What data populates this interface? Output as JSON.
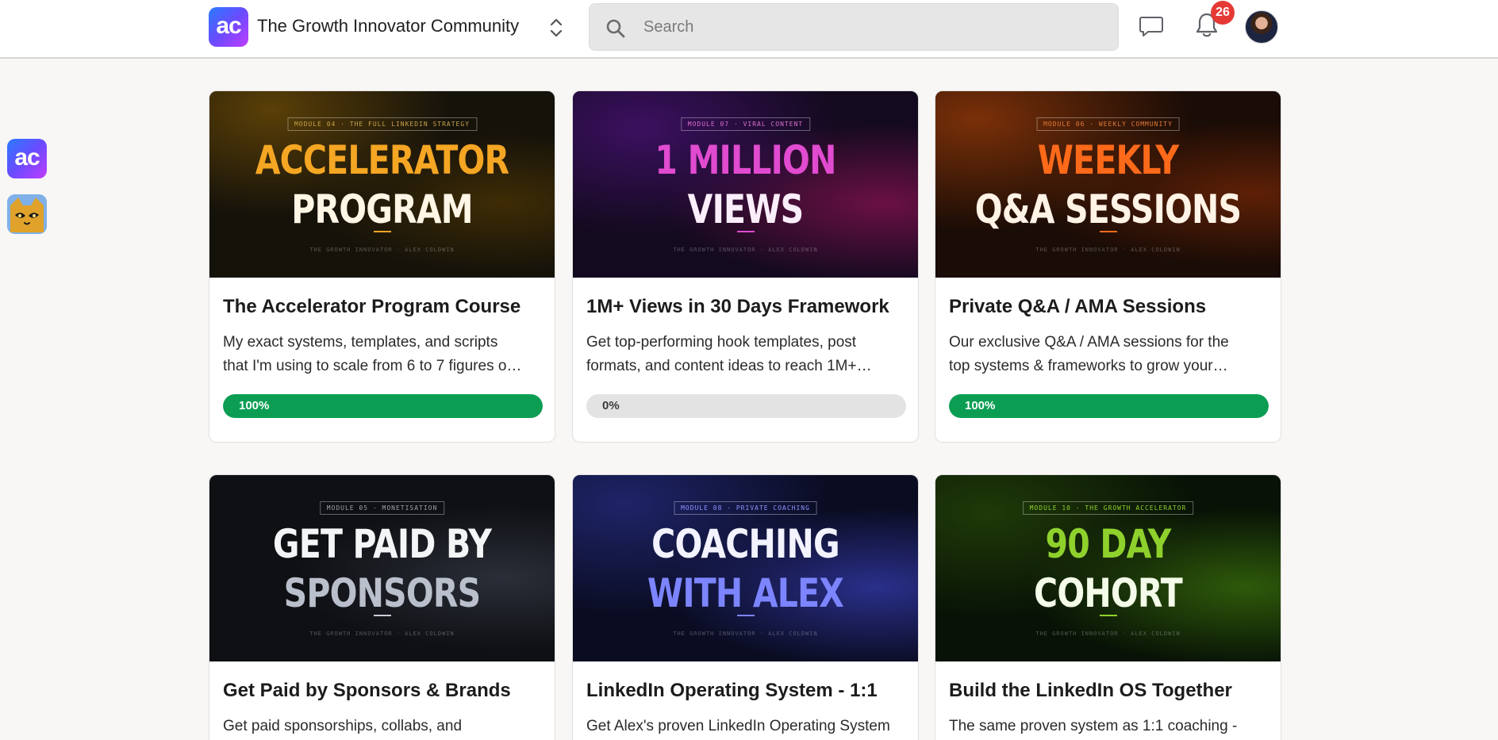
{
  "header": {
    "logo_text": "ac",
    "community_name": "The Growth Innovator Community",
    "search_placeholder": "Search",
    "notification_count": "26"
  },
  "rail": {
    "items": [
      {
        "label": "ac",
        "icon": "ac-logo-icon"
      },
      {
        "label": "",
        "icon": "cat-avatar-icon"
      }
    ]
  },
  "courses": [
    {
      "thumb_tag": "MODULE 04 · THE FULL LINKEDIN STRATEGY",
      "thumb_line1": "ACCELERATOR",
      "thumb_line2": "PROGRAM",
      "thumb_foot": "THE GROWTH INNOVATOR · ALEX COLDWIN",
      "title": "The Accelerator Program Course",
      "desc_line1": "My exact systems, templates, and scripts",
      "desc_line2": "that I'm using to scale from 6 to 7 figures o…",
      "progress_label": "100%",
      "progress": 1.0,
      "accent": "#f5a623"
    },
    {
      "thumb_tag": "MODULE 07 · VIRAL CONTENT",
      "thumb_line1": "1 MILLION",
      "thumb_line2": "VIEWS",
      "thumb_foot": "THE GROWTH INNOVATOR · ALEX COLDWIN",
      "title": "1M+ Views in 30 Days Framework",
      "desc_line1": "Get top-performing hook templates, post",
      "desc_line2": "formats, and content ideas to reach 1M+…",
      "progress_label": "0%",
      "progress": 0.0,
      "accent": "#e04bd0"
    },
    {
      "thumb_tag": "MODULE 06 · WEEKLY COMMUNITY",
      "thumb_line1": "WEEKLY",
      "thumb_line2": "Q&A SESSIONS",
      "thumb_foot": "THE GROWTH INNOVATOR · ALEX COLDWIN",
      "title": "Private Q&A / AMA Sessions",
      "desc_line1": "Our exclusive Q&A / AMA sessions for the",
      "desc_line2": "top systems & frameworks to grow your…",
      "progress_label": "100%",
      "progress": 1.0,
      "accent": "#ff6a1a"
    },
    {
      "thumb_tag": "MODULE 05 · MONETISATION",
      "thumb_line1": "GET PAID BY",
      "thumb_line2": "SPONSORS",
      "thumb_foot": "THE GROWTH INNOVATOR · ALEX COLDWIN",
      "title": "Get Paid by Sponsors & Brands",
      "desc_line1": "Get paid sponsorships, collabs, and",
      "desc_line2": "",
      "progress_label": "",
      "progress": null,
      "accent": "#c9ced8"
    },
    {
      "thumb_tag": "MODULE 08 · PRIVATE COACHING",
      "thumb_line1": "COACHING",
      "thumb_line2": "WITH ALEX",
      "thumb_foot": "THE GROWTH INNOVATOR · ALEX COLDWIN",
      "title": "LinkedIn Operating System - 1:1",
      "desc_line1": "Get Alex's proven LinkedIn Operating System",
      "desc_line2": "",
      "progress_label": "",
      "progress": null,
      "accent": "#7c85ff"
    },
    {
      "thumb_tag": "MODULE 10 · THE GROWTH ACCELERATOR",
      "thumb_line1": "90 DAY",
      "thumb_line2": "COHORT",
      "thumb_foot": "THE GROWTH INNOVATOR · ALEX COLDWIN",
      "title": "Build the LinkedIn OS Together",
      "desc_line1": "The same proven system as 1:1 coaching -",
      "desc_line2": "",
      "progress_label": "",
      "progress": null,
      "accent": "#8fd12c"
    }
  ]
}
